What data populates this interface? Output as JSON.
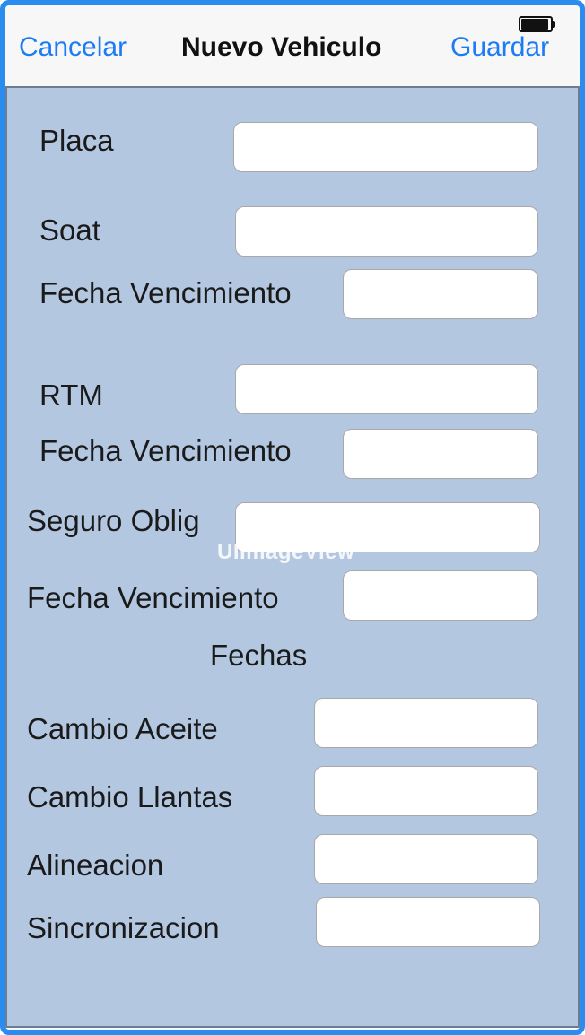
{
  "navbar": {
    "cancel_label": "Cancelar",
    "title": "Nuevo Vehiculo",
    "save_label": "Guardar"
  },
  "form": {
    "placa_label": "Placa",
    "soat_label": "Soat",
    "soat_fecha_label": "Fecha Vencimiento",
    "rtm_label": "RTM",
    "rtm_fecha_label": "Fecha Vencimiento",
    "seguro_label": "Seguro Oblig",
    "seguro_fecha_label": "Fecha Vencimiento",
    "section_fechas": "Fechas",
    "cambio_aceite_label": "Cambio Aceite",
    "cambio_llantas_label": "Cambio Llantas",
    "alineacion_label": "Alineacion",
    "sincronizacion_label": "Sincronizacion"
  },
  "overlay": {
    "watermark": "UIImageView"
  },
  "colors": {
    "accent": "#1c7cf4",
    "content_background": "#b3c7e1",
    "frame_border": "#2b8cf0"
  }
}
